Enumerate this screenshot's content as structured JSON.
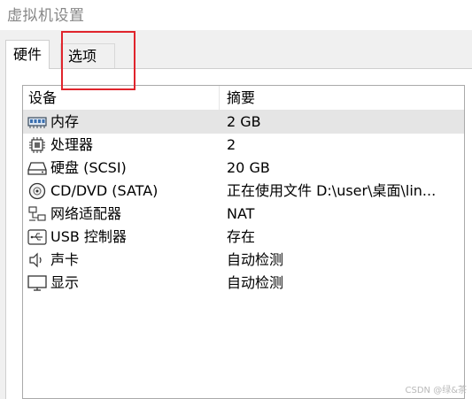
{
  "window": {
    "title": "虚拟机设置"
  },
  "tabs": [
    {
      "label": "硬件",
      "active": true
    },
    {
      "label": "选项",
      "active": false
    }
  ],
  "list": {
    "columns": [
      "设备",
      "摘要"
    ],
    "rows": [
      {
        "icon": "memory-icon",
        "name": "内存",
        "summary": "2 GB",
        "selected": true
      },
      {
        "icon": "cpu-icon",
        "name": "处理器",
        "summary": "2",
        "selected": false
      },
      {
        "icon": "harddisk-icon",
        "name": "硬盘 (SCSI)",
        "summary": "20 GB",
        "selected": false
      },
      {
        "icon": "cd-dvd-icon",
        "name": "CD/DVD (SATA)",
        "summary": "正在使用文件 D:\\user\\桌面\\lin...",
        "selected": false
      },
      {
        "icon": "network-icon",
        "name": "网络适配器",
        "summary": "NAT",
        "selected": false
      },
      {
        "icon": "usb-icon",
        "name": "USB 控制器",
        "summary": "存在",
        "selected": false
      },
      {
        "icon": "sound-icon",
        "name": "声卡",
        "summary": "自动检测",
        "selected": false
      },
      {
        "icon": "display-icon",
        "name": "显示",
        "summary": "自动检测",
        "selected": false
      }
    ]
  },
  "annotation": {
    "color": "#e0242c"
  },
  "watermark": "CSDN @绿&茶"
}
